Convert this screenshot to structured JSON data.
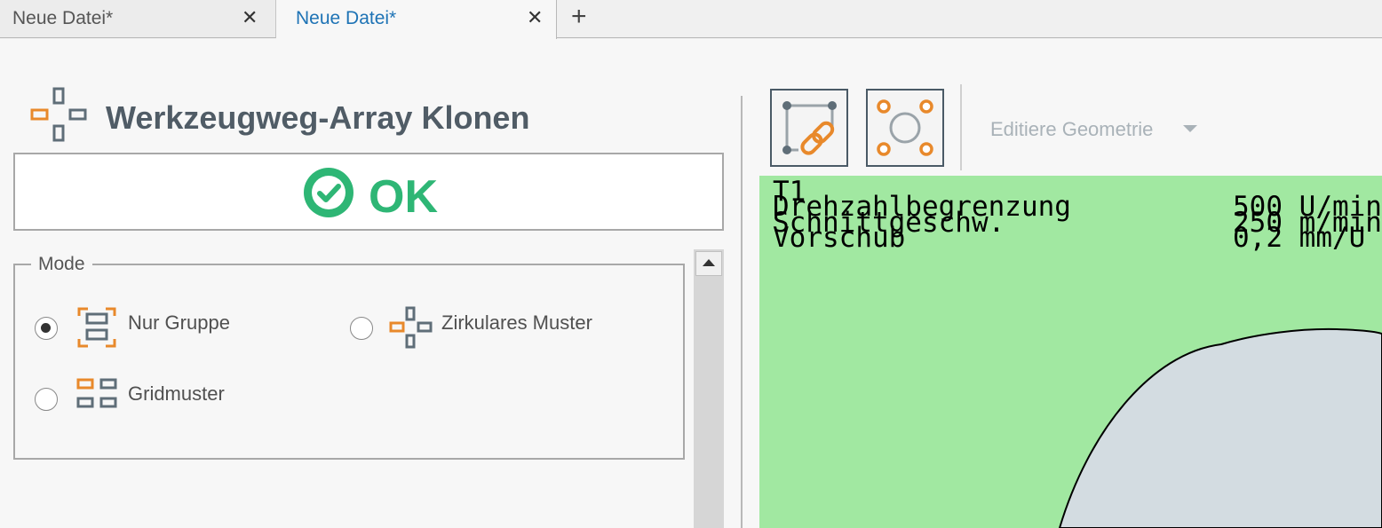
{
  "tabs": [
    {
      "label": "Neue Datei*",
      "active": false
    },
    {
      "label": "Neue Datei*",
      "active": true
    }
  ],
  "tab_close_symbol": "✕",
  "tab_add_symbol": "+",
  "panel": {
    "title": "Werkzeugweg-Array Klonen",
    "icon": "array-clone-icon",
    "ok_label": "OK",
    "ok_icon": "check-circle-icon"
  },
  "mode": {
    "legend": "Mode",
    "options": [
      {
        "label": "Nur Gruppe",
        "icon": "group-icon",
        "selected": true
      },
      {
        "label": "Zirkulares Muster",
        "icon": "circular-pattern-icon",
        "selected": false
      },
      {
        "label": "Gridmuster",
        "icon": "grid-pattern-icon",
        "selected": false
      }
    ]
  },
  "toolbar": {
    "link_button_icon": "link-geometry-icon",
    "circle_button_icon": "circle-points-icon",
    "edit_geometry_label": "Editiere Geometrie"
  },
  "viewport": {
    "tool": "T1",
    "params": [
      {
        "name": "Drehzahlbegrenzung",
        "value": "500 U/min"
      },
      {
        "name": "Schnittgeschw.",
        "value": "250 m/min"
      },
      {
        "name": "Vorschub",
        "value": "0,2 mm/U"
      }
    ]
  },
  "colors": {
    "accent_orange": "#e8892b",
    "icon_gray": "#5f6e78",
    "ok_green": "#2eb675",
    "tab_active_blue": "#1e73b5",
    "viewport_bg": "#a1e8a1",
    "workpiece_fill": "#d3dce1"
  }
}
